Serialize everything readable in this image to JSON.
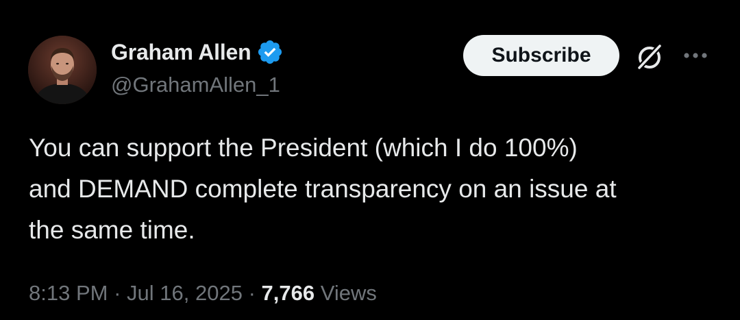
{
  "author": {
    "display_name": "Graham Allen",
    "handle": "@GrahamAllen_1",
    "verified": true,
    "verified_color": "#1d9bf0"
  },
  "actions": {
    "subscribe_label": "Subscribe",
    "grok_icon": "grok-icon",
    "more_icon": "more-icon"
  },
  "tweet": {
    "text": "You can support the President (which I do 100%)\nand DEMAND complete transparency on an issue at\nthe same time."
  },
  "meta": {
    "time": "8:13 PM",
    "separator": "·",
    "date": "Jul 16, 2025",
    "views_count": "7,766",
    "views_label": "Views"
  },
  "colors": {
    "background": "#000000",
    "primary_text": "#e7e9ea",
    "secondary_text": "#71767b",
    "subscribe_bg": "#eff3f4"
  }
}
